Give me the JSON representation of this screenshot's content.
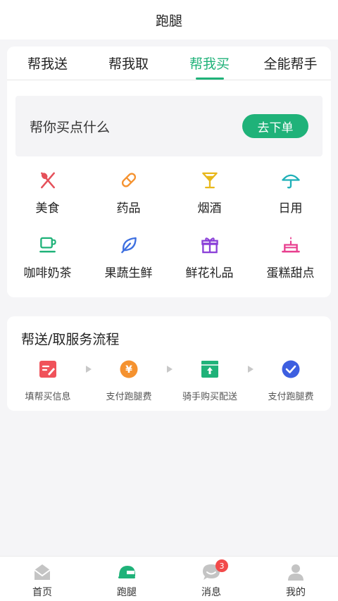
{
  "header": {
    "title": "跑腿"
  },
  "tabs": [
    {
      "label": "帮我送",
      "active": false
    },
    {
      "label": "帮我取",
      "active": false
    },
    {
      "label": "帮我买",
      "active": true
    },
    {
      "label": "全能帮手",
      "active": false
    }
  ],
  "order_box": {
    "title": "帮你买点什么",
    "button_label": "去下单"
  },
  "categories": [
    {
      "label": "美食",
      "icon": "utensils-icon",
      "color": "#e5505a"
    },
    {
      "label": "药品",
      "icon": "pill-icon",
      "color": "#f5922f"
    },
    {
      "label": "烟酒",
      "icon": "cocktail-icon",
      "color": "#e8b81c"
    },
    {
      "label": "日用",
      "icon": "umbrella-icon",
      "color": "#1fb0b8"
    },
    {
      "label": "咖啡奶茶",
      "icon": "coffee-cup-icon",
      "color": "#1fb279"
    },
    {
      "label": "果蔬生鲜",
      "icon": "leaf-icon",
      "color": "#3d6fe0"
    },
    {
      "label": "鲜花礼品",
      "icon": "gift-icon",
      "color": "#8a3fd8"
    },
    {
      "label": "蛋糕甜点",
      "icon": "cake-icon",
      "color": "#e83f8f"
    }
  ],
  "flow": {
    "title": "帮送/取服务流程",
    "steps": [
      {
        "label": "填帮买信息",
        "icon": "edit-form-icon",
        "color": "#f0525a"
      },
      {
        "label": "支付跑腿费",
        "icon": "yuan-coin-icon",
        "color": "#f5922f"
      },
      {
        "label": "骑手购买配送",
        "icon": "upload-box-icon",
        "color": "#1fb279"
      },
      {
        "label": "支付跑腿费",
        "icon": "check-circle-icon",
        "color": "#3d5fe0"
      }
    ]
  },
  "bottom_nav": [
    {
      "label": "首页",
      "icon": "home-mail-icon",
      "active": false
    },
    {
      "label": "跑腿",
      "icon": "helmet-icon",
      "active": true
    },
    {
      "label": "消息",
      "icon": "chat-bubble-icon",
      "active": false,
      "badge": "3"
    },
    {
      "label": "我的",
      "icon": "user-icon",
      "active": false
    }
  ],
  "colors": {
    "accent": "#1fb279",
    "background": "#f5f5f7",
    "badge": "#f24a4a"
  }
}
